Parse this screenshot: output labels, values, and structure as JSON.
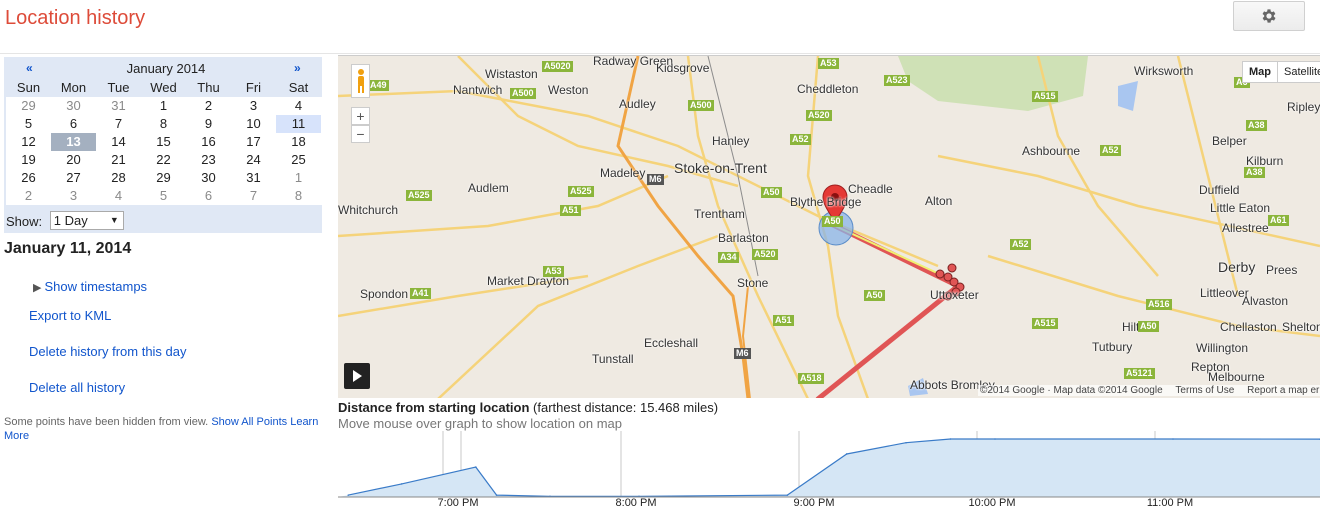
{
  "header": {
    "title": "Location history",
    "settings_icon": "gear-icon"
  },
  "calendar": {
    "prev": "«",
    "next": "»",
    "month": "January 2014",
    "weekdays": [
      "Sun",
      "Mon",
      "Tue",
      "Wed",
      "Thu",
      "Fri",
      "Sat"
    ],
    "weeks": [
      [
        {
          "d": "29",
          "m": true
        },
        {
          "d": "30",
          "m": true
        },
        {
          "d": "31",
          "m": true
        },
        {
          "d": "1",
          "c": true
        },
        {
          "d": "2",
          "c": true
        },
        {
          "d": "3",
          "c": true
        },
        {
          "d": "4",
          "c": true
        }
      ],
      [
        {
          "d": "5",
          "c": true
        },
        {
          "d": "6",
          "c": true
        },
        {
          "d": "7",
          "c": true
        },
        {
          "d": "8",
          "c": true
        },
        {
          "d": "9",
          "c": true
        },
        {
          "d": "10",
          "c": true
        },
        {
          "d": "11",
          "c": true,
          "selected": true
        }
      ],
      [
        {
          "d": "12",
          "c": true
        },
        {
          "d": "13",
          "c": true,
          "today": true
        },
        {
          "d": "14",
          "c": true
        },
        {
          "d": "15",
          "c": true
        },
        {
          "d": "16",
          "c": true
        },
        {
          "d": "17",
          "c": true
        },
        {
          "d": "18",
          "c": true
        }
      ],
      [
        {
          "d": "19",
          "c": true
        },
        {
          "d": "20",
          "c": true
        },
        {
          "d": "21",
          "c": true
        },
        {
          "d": "22",
          "c": true
        },
        {
          "d": "23",
          "c": true
        },
        {
          "d": "24",
          "c": true
        },
        {
          "d": "25",
          "c": true
        }
      ],
      [
        {
          "d": "26",
          "c": true
        },
        {
          "d": "27",
          "c": true
        },
        {
          "d": "28",
          "c": true
        },
        {
          "d": "29",
          "c": true
        },
        {
          "d": "30",
          "c": true
        },
        {
          "d": "31",
          "c": true
        },
        {
          "d": "1",
          "m": true
        }
      ],
      [
        {
          "d": "2",
          "m": true
        },
        {
          "d": "3",
          "m": true
        },
        {
          "d": "4",
          "m": true
        },
        {
          "d": "5",
          "m": true
        },
        {
          "d": "6",
          "m": true
        },
        {
          "d": "7",
          "m": true
        },
        {
          "d": "8",
          "m": true
        }
      ]
    ],
    "show_label": "Show:",
    "show_value": "1 Day"
  },
  "sidebar": {
    "date_heading": "January 11, 2014",
    "show_timestamps": "Show timestamps",
    "export_kml": "Export to KML",
    "delete_day": "Delete history from this day",
    "delete_all": "Delete all history",
    "hidden_note": "Some points have been hidden from view.",
    "show_all_points": "Show All Points",
    "learn_more": "Learn More"
  },
  "map": {
    "map_type_map": "Map",
    "map_type_satellite": "Satellite",
    "zoom_in": "+",
    "zoom_out": "−",
    "attribution": "©2014 Google · Map data ©2014 Google",
    "terms": "Terms of Use",
    "report": "Report a map error",
    "places": [
      "Wistaston",
      "Radway Green",
      "Kidsgrove",
      "Cheddleton",
      "Wirksworth",
      "Nantwich",
      "Weston",
      "Audley",
      "Hanley",
      "Ashbourne",
      "Belper",
      "Ripley",
      "Madeley",
      "Stoke-on-Trent",
      "Cheadle",
      "Kilburn",
      "Audlem",
      "Trentham",
      "Blythe Bridge",
      "Alton",
      "Duffield",
      "Whitchurch",
      "Barlaston",
      "Little Eaton",
      "Allestree",
      "Market Drayton",
      "Stone",
      "Uttoxeter",
      "Derby",
      "Spondon",
      "Prees",
      "Littleover",
      "Alvaston",
      "Eccleshall",
      "Hilton",
      "Chellaston",
      "Shelton",
      "Tutbury",
      "Willington",
      "Tunstall",
      "Repton",
      "Abbots Bromley",
      "Melbourne"
    ],
    "roads": [
      "A49",
      "A5020",
      "A500",
      "A53",
      "A523",
      "A515",
      "A6",
      "A500",
      "A520",
      "A52",
      "A52",
      "A38",
      "A525",
      "A525",
      "A51",
      "A50",
      "A50",
      "A52",
      "A61",
      "A38",
      "A41",
      "A53",
      "A34",
      "A520",
      "A50",
      "A516",
      "A50",
      "A515",
      "A51",
      "A5121",
      "A518",
      "M6",
      "M6"
    ]
  },
  "chart": {
    "title": "Distance from starting location",
    "subtitle": "(farthest distance: 15.468 miles)",
    "hint": "Move mouse over graph to show location on map",
    "ticks": [
      "7:00 PM",
      "8:00 PM",
      "9:00 PM",
      "10:00 PM",
      "11:00 PM"
    ]
  },
  "chart_data": {
    "type": "area",
    "ylabel": "",
    "xlabel": "",
    "x": [
      "6:22 PM",
      "6:40 PM",
      "7:05 PM",
      "7:12 PM",
      "7:30 PM",
      "8:00 PM",
      "8:50 PM",
      "9:10 PM",
      "9:30 PM",
      "9:45 PM",
      "10:00 PM",
      "11:00 PM",
      "11:50 PM"
    ],
    "values": [
      0.5,
      3.5,
      8.0,
      0.5,
      0.2,
      0.2,
      0.5,
      11.5,
      14.5,
      15.5,
      15.5,
      15.5,
      15.468
    ],
    "ylim": [
      0,
      15.5
    ],
    "grid": true
  }
}
